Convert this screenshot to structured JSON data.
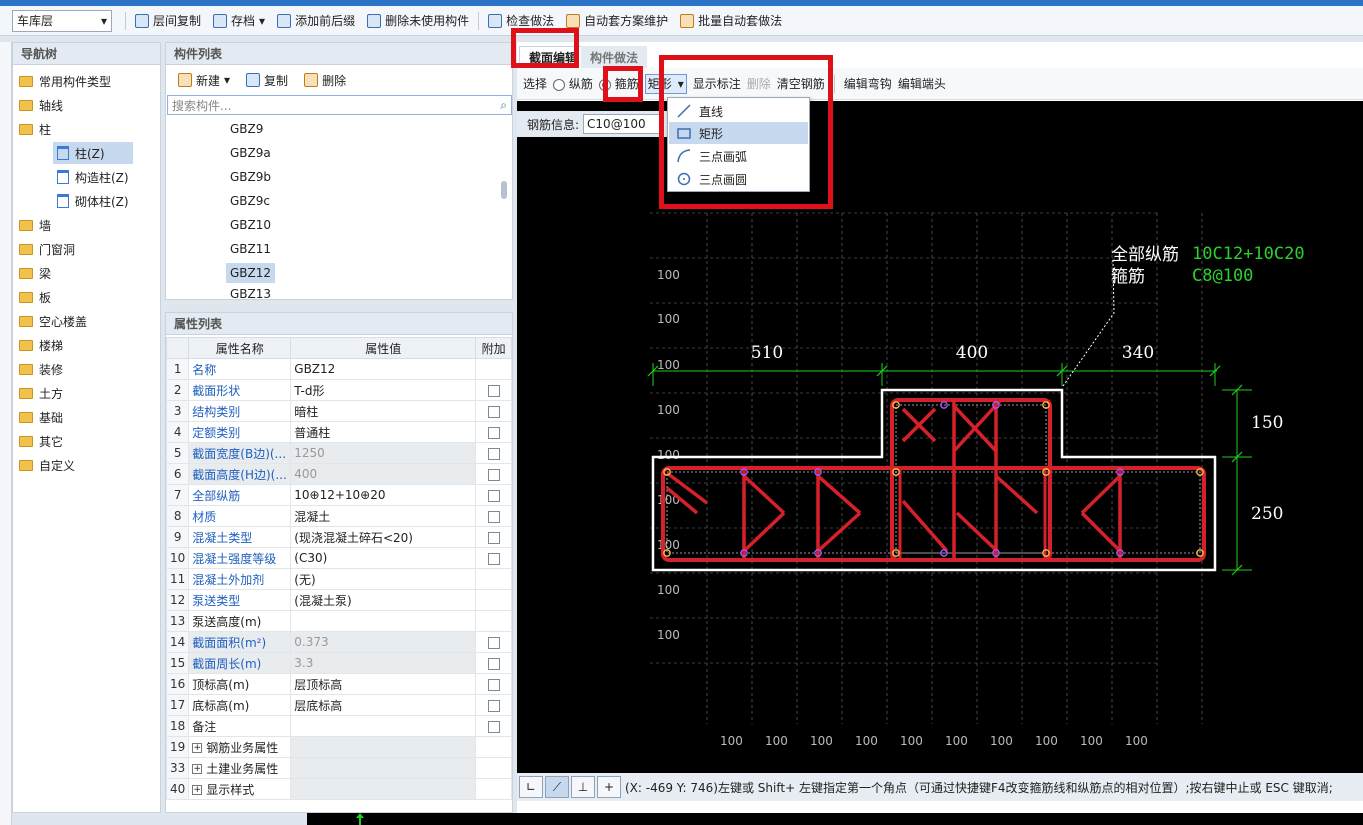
{
  "toolbar": {
    "floor": "车库层",
    "copy_between_floors": "层间复制",
    "save": "存档",
    "add_prefix_suffix": "添加前后缀",
    "delete_unused": "删除未使用构件",
    "check_method": "检查做法",
    "auto_scheme": "自动套方案维护",
    "batch_auto": "批量自动套做法"
  },
  "nav": {
    "title": "导航树",
    "items": [
      "常用构件类型",
      "轴线",
      "柱",
      "柱(Z)",
      "构造柱(Z)",
      "砌体柱(Z)",
      "墙",
      "门窗洞",
      "梁",
      "板",
      "空心楼盖",
      "楼梯",
      "装修",
      "土方",
      "基础",
      "其它",
      "自定义"
    ]
  },
  "components": {
    "title": "构件列表",
    "new": "新建",
    "copy": "复制",
    "delete": "删除",
    "search_placeholder": "搜索构件...",
    "items": [
      "GBZ9",
      "GBZ9a",
      "GBZ9b",
      "GBZ9c",
      "GBZ10",
      "GBZ11",
      "GBZ12",
      "GBZ13"
    ],
    "selected": "GBZ12"
  },
  "properties": {
    "title": "属性列表",
    "headers": [
      "属性名称",
      "属性值",
      "附加"
    ],
    "rows": [
      {
        "n": "1",
        "name": "名称",
        "value": "GBZ12"
      },
      {
        "n": "2",
        "name": "截面形状",
        "value": "T-d形"
      },
      {
        "n": "3",
        "name": "结构类别",
        "value": "暗柱"
      },
      {
        "n": "4",
        "name": "定额类别",
        "value": "普通柱"
      },
      {
        "n": "5",
        "name": "截面宽度(B边)(...",
        "value": "1250"
      },
      {
        "n": "6",
        "name": "截面高度(H边)(...",
        "value": "400"
      },
      {
        "n": "7",
        "name": "全部纵筋",
        "value": "10⊕12+10⊕20"
      },
      {
        "n": "8",
        "name": "材质",
        "value": "混凝土"
      },
      {
        "n": "9",
        "name": "混凝土类型",
        "value": "(现浇混凝土碎石<20)"
      },
      {
        "n": "10",
        "name": "混凝土强度等级",
        "value": "(C30)"
      },
      {
        "n": "11",
        "name": "混凝土外加剂",
        "value": "(无)"
      },
      {
        "n": "12",
        "name": "泵送类型",
        "value": "(混凝土泵)"
      },
      {
        "n": "13",
        "name": "泵送高度(m)",
        "value": ""
      },
      {
        "n": "14",
        "name": "截面面积(m²)",
        "value": "0.373"
      },
      {
        "n": "15",
        "name": "截面周长(m)",
        "value": "3.3"
      },
      {
        "n": "16",
        "name": "顶标高(m)",
        "value": "层顶标高"
      },
      {
        "n": "17",
        "name": "底标高(m)",
        "value": "层底标高"
      },
      {
        "n": "18",
        "name": "备注",
        "value": ""
      },
      {
        "n": "19",
        "name": "钢筋业务属性",
        "value": ""
      },
      {
        "n": "33",
        "name": "土建业务属性",
        "value": ""
      },
      {
        "n": "40",
        "name": "显示样式",
        "value": ""
      }
    ]
  },
  "editor": {
    "tab_section": "截面编辑",
    "tab_method": "构件做法",
    "select": "选择",
    "longitudinal": "纵筋",
    "stirrup": "箍筋",
    "shape": "矩形",
    "show_label": "显示标注",
    "delete": "删除",
    "clear_rebar": "清空钢筋",
    "edit_bend": "编辑弯钩",
    "edit_end": "编辑端头",
    "rebar_info_label": "钢筋信息:",
    "rebar_info_value": "C10@100",
    "dropdown": [
      "直线",
      "矩形",
      "三点画弧",
      "三点画圆"
    ],
    "dropdown_selected": "矩形"
  },
  "drawing": {
    "label_all_long": "全部纵筋",
    "label_stirrup": "箍筋",
    "value_all_long": "10C12+10C20",
    "value_stirrup": "C8@100",
    "dims_top": [
      "510",
      "400",
      "340"
    ],
    "dims_right": [
      "150",
      "250"
    ],
    "grid_label": "100"
  },
  "status": {
    "text": "(X: -469 Y: 746)左键或 Shift+ 左键指定第一个角点（可通过快捷键F4改变箍筋线和纵筋点的相对位置）;按右键中止或 ESC 键取消;"
  },
  "colors": {
    "highlight_red": "#e0101a",
    "rebar_red": "#d6202a",
    "dim_green": "#1ed01e",
    "label_green": "#2bd12b"
  }
}
